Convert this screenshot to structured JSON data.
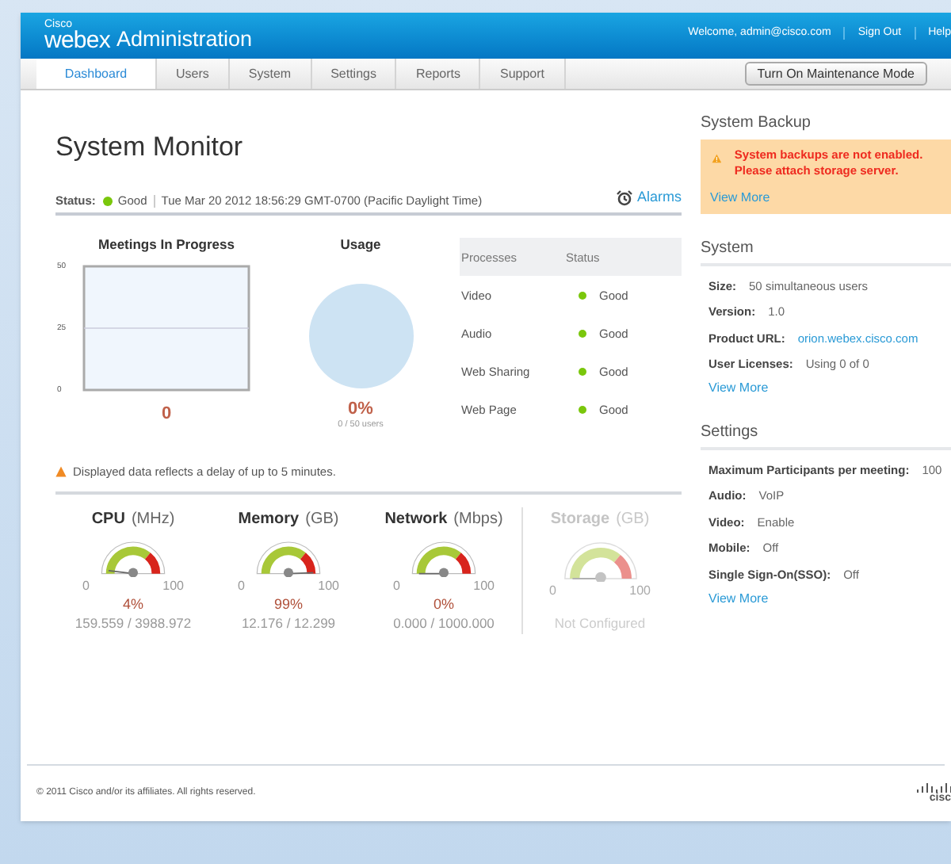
{
  "header": {
    "brand_small": "Cisco",
    "brand": "webex",
    "title": "Administration",
    "welcome": "Welcome, admin@cisco.com",
    "links": [
      "Sign Out",
      "Help"
    ]
  },
  "tabs": [
    {
      "label": "Dashboard",
      "selected": true
    },
    {
      "label": "Users",
      "selected": false
    },
    {
      "label": "System",
      "selected": false
    },
    {
      "label": "Settings",
      "selected": false
    },
    {
      "label": "Reports",
      "selected": false
    },
    {
      "label": "Support",
      "selected": false
    }
  ],
  "maintenance_button": "Turn On Maintenance Mode",
  "monitor": {
    "title": "System Monitor",
    "status_label": "Status:",
    "status": "Good",
    "timestamp": "Tue Mar 20 2012 18:56:29 GMT-0700 (Pacific Daylight Time)",
    "alarms": "Alarms",
    "meetings": {
      "title": "Meetings In Progress",
      "value": "0",
      "y_ticks": [
        "50",
        "25",
        "0"
      ]
    },
    "usage": {
      "title": "Usage",
      "percent": "0%",
      "detail": "0 / 50 users"
    },
    "processes": {
      "columns": [
        "Processes",
        "Status"
      ],
      "rows": [
        {
          "name": "Video",
          "status": "Good",
          "color": "#7ac70c"
        },
        {
          "name": "Audio",
          "status": "Good",
          "color": "#7ac70c"
        },
        {
          "name": "Web Sharing",
          "status": "Good",
          "color": "#7ac70c"
        },
        {
          "name": "Web Page",
          "status": "Good",
          "color": "#7ac70c"
        }
      ]
    },
    "delay_note": "Displayed data reflects a delay of up to 5 minutes.",
    "gauges": [
      {
        "name": "CPU",
        "unit": "(MHz)",
        "min": "0",
        "max": "100",
        "percent": "4%",
        "detail": "159.559 / 3988.972",
        "disabled": false
      },
      {
        "name": "Memory",
        "unit": "(GB)",
        "min": "0",
        "max": "100",
        "percent": "99%",
        "detail": "12.176 / 12.299",
        "disabled": false
      },
      {
        "name": "Network",
        "unit": "(Mbps)",
        "min": "0",
        "max": "100",
        "percent": "0%",
        "detail": "0.000 / 1000.000",
        "disabled": false
      },
      {
        "name": "Storage",
        "unit": "(GB)",
        "min": "0",
        "max": "100",
        "detail": "Not Configured",
        "disabled": true
      }
    ]
  },
  "backup": {
    "title": "System Backup",
    "message": "System backups are not enabled. Please attach storage server.",
    "link": "View More"
  },
  "system": {
    "title": "System",
    "fields": [
      {
        "label": "Size:",
        "value": "50 simultaneous users",
        "kind": "text"
      },
      {
        "label": "Version:",
        "value": "1.0",
        "kind": "text"
      },
      {
        "label": "Product URL:",
        "value": "orion.webex.cisco.com",
        "kind": "link"
      },
      {
        "label": "User Licenses:",
        "value": "Using 0 of 0",
        "kind": "text"
      }
    ],
    "link": "View More"
  },
  "settings": {
    "title": "Settings",
    "fields": [
      {
        "label": "Maximum Participants per meeting:",
        "value": "100",
        "kind": "text"
      },
      {
        "label": "Audio:",
        "value": "VoIP",
        "kind": "text"
      },
      {
        "label": "Video:",
        "value": "Enable",
        "kind": "text"
      },
      {
        "label": "Mobile:",
        "value": "Off",
        "kind": "text"
      },
      {
        "label": "Single Sign-On(SSO):",
        "value": "Off",
        "kind": "text"
      }
    ],
    "link": "View More"
  },
  "footer": {
    "copyright": "© 2011 Cisco and/or its affiliates. All rights reserved.",
    "logo": "cisc"
  }
}
